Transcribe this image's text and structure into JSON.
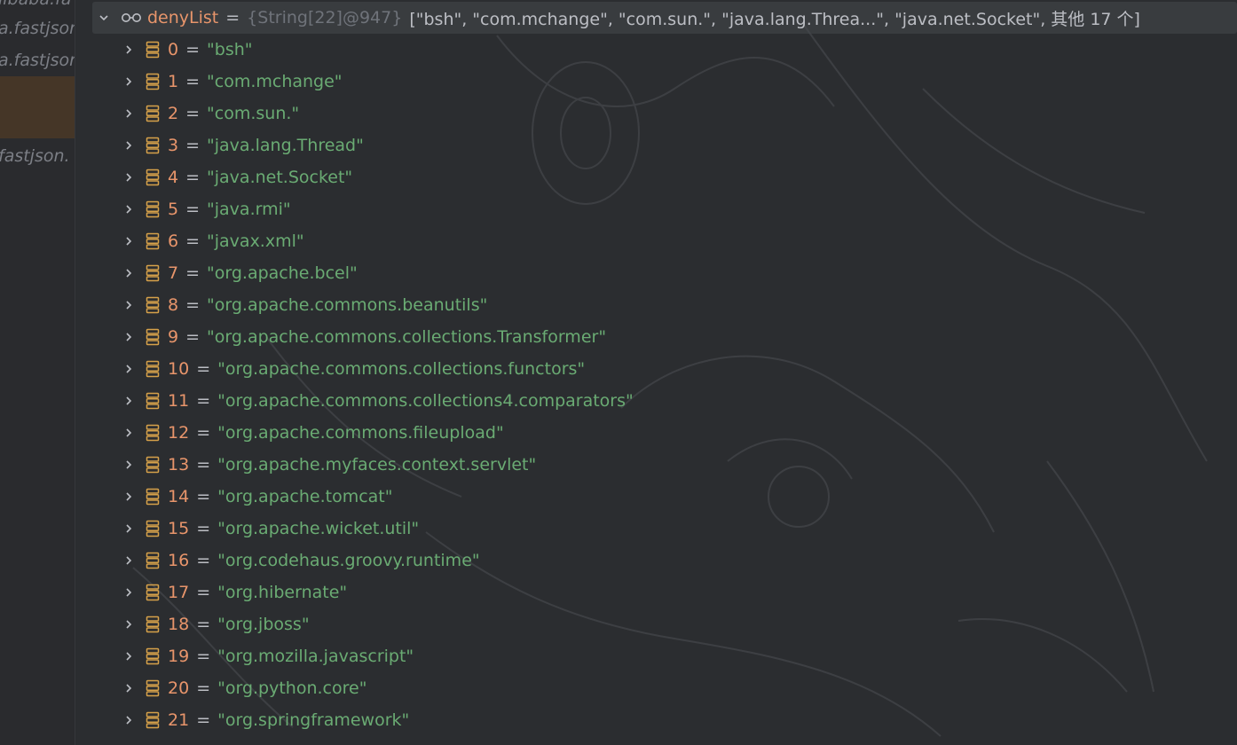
{
  "colors": {
    "background": "#2b2d30",
    "variable_name": "#e8956b",
    "string_value": "#6aab73",
    "type_info": "#6f737a",
    "icon_field": "#d6a14a"
  },
  "gutter": {
    "lines": [
      "libaba.fa",
      "a.fastjson",
      "a.fastjson",
      "fastjson."
    ]
  },
  "root": {
    "expand_icon": "chevron-down-icon",
    "watch_icon": "glasses-icon",
    "name": "denyList",
    "equals": "=",
    "type": "{String[22]@947}",
    "preview": "[\"bsh\", \"com.mchange\", \"com.sun.\", \"java.lang.Threa...\", \"java.net.Socket\", 其他 17 个]"
  },
  "items": [
    {
      "index": "0",
      "value": "\"bsh\""
    },
    {
      "index": "1",
      "value": "\"com.mchange\""
    },
    {
      "index": "2",
      "value": "\"com.sun.\""
    },
    {
      "index": "3",
      "value": "\"java.lang.Thread\""
    },
    {
      "index": "4",
      "value": "\"java.net.Socket\""
    },
    {
      "index": "5",
      "value": "\"java.rmi\""
    },
    {
      "index": "6",
      "value": "\"javax.xml\""
    },
    {
      "index": "7",
      "value": "\"org.apache.bcel\""
    },
    {
      "index": "8",
      "value": "\"org.apache.commons.beanutils\""
    },
    {
      "index": "9",
      "value": "\"org.apache.commons.collections.Transformer\""
    },
    {
      "index": "10",
      "value": "\"org.apache.commons.collections.functors\""
    },
    {
      "index": "11",
      "value": "\"org.apache.commons.collections4.comparators\""
    },
    {
      "index": "12",
      "value": "\"org.apache.commons.fileupload\""
    },
    {
      "index": "13",
      "value": "\"org.apache.myfaces.context.servlet\""
    },
    {
      "index": "14",
      "value": "\"org.apache.tomcat\""
    },
    {
      "index": "15",
      "value": "\"org.apache.wicket.util\""
    },
    {
      "index": "16",
      "value": "\"org.codehaus.groovy.runtime\""
    },
    {
      "index": "17",
      "value": "\"org.hibernate\""
    },
    {
      "index": "18",
      "value": "\"org.jboss\""
    },
    {
      "index": "19",
      "value": "\"org.mozilla.javascript\""
    },
    {
      "index": "20",
      "value": "\"org.python.core\""
    },
    {
      "index": "21",
      "value": "\"org.springframework\""
    }
  ]
}
